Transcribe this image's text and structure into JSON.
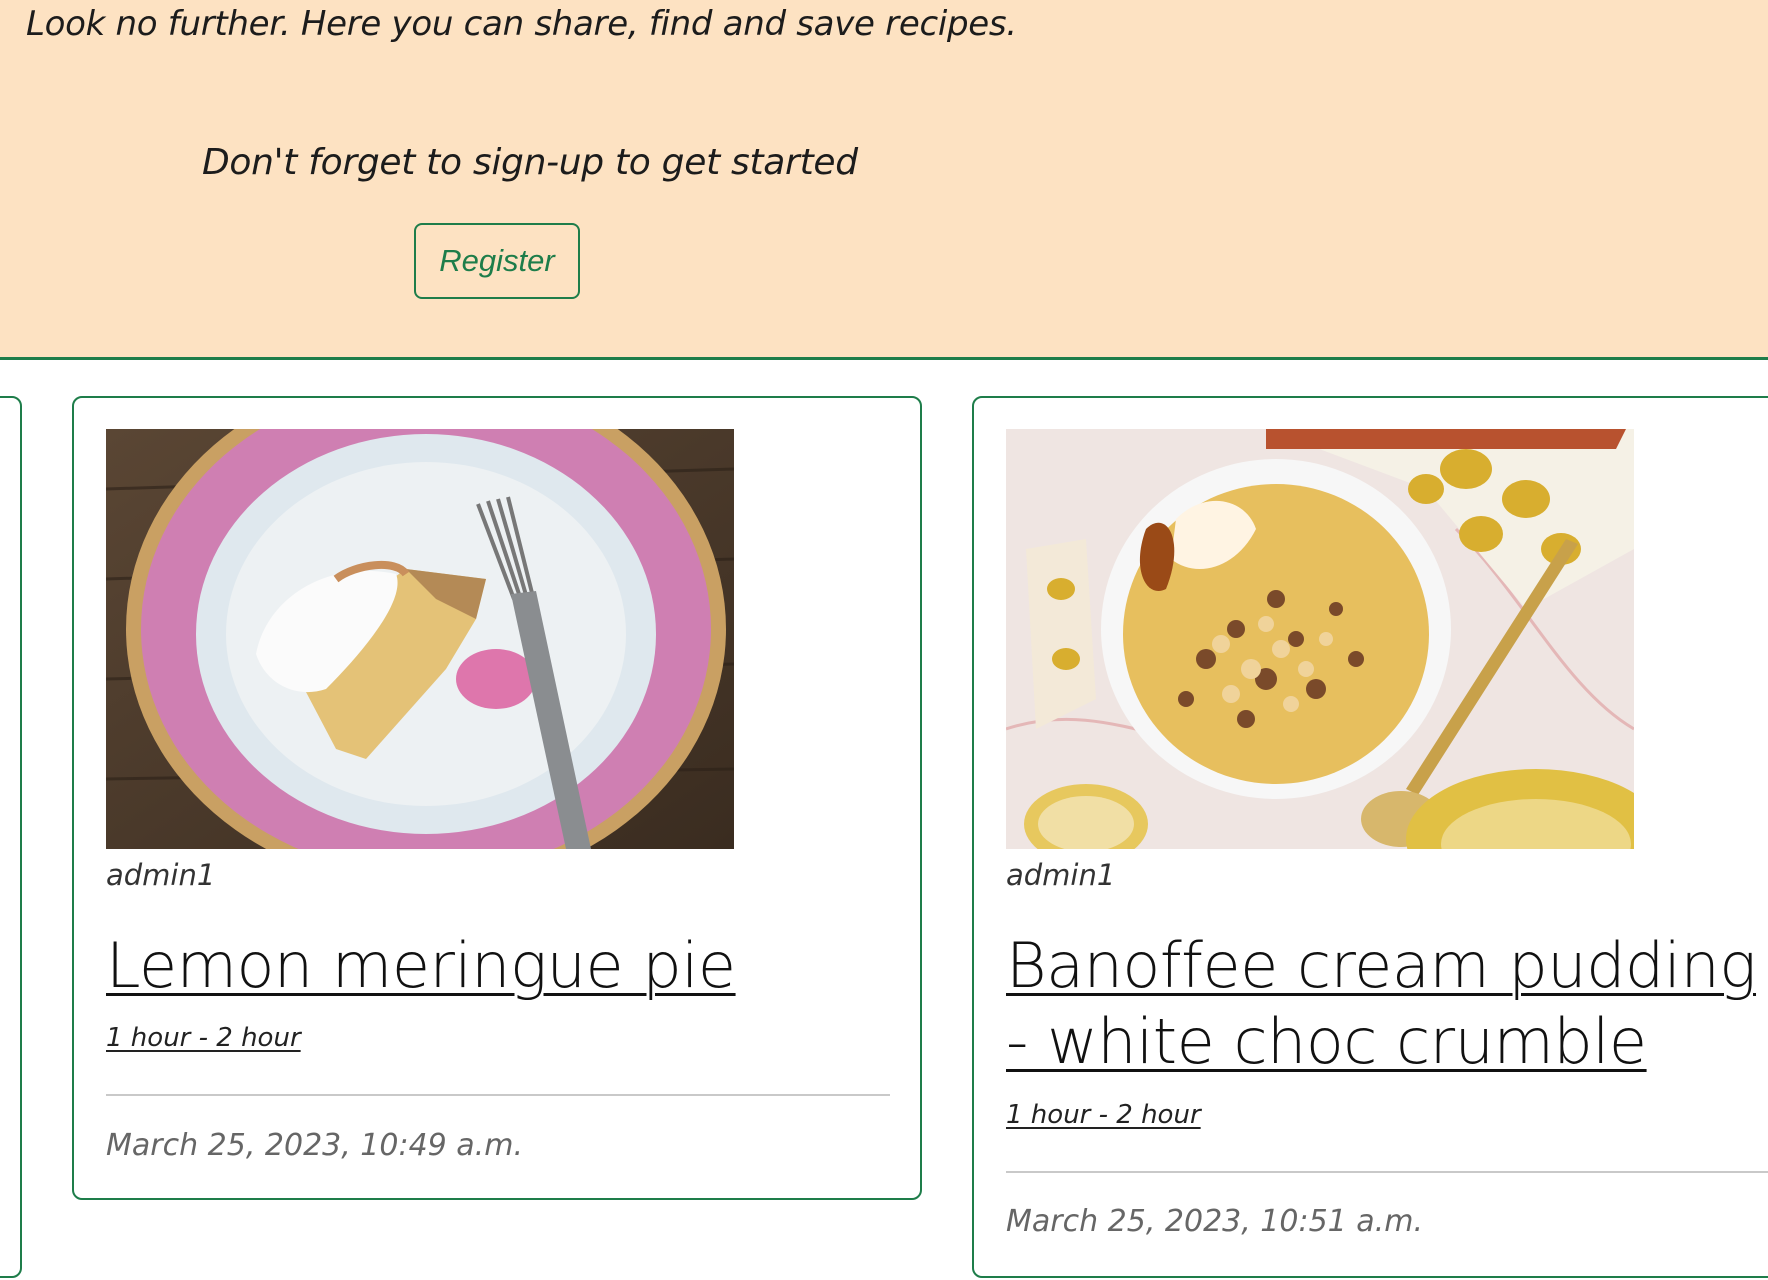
{
  "hero": {
    "tagline": "Look no further. Here you can share, find and save recipes.",
    "signup_prompt": "Don't forget to sign-up to get started",
    "register_label": "Register"
  },
  "recipes": [
    {
      "author": "admin1",
      "title": "Lemon meringue pie",
      "time": "1 hour - 2 hour",
      "date": "March 25, 2023, 10:49 a.m."
    },
    {
      "author": "admin1",
      "title": "Banoffee cream pudding - white choc crumble",
      "time": "1 hour - 2 hour",
      "date": "March 25, 2023, 10:51 a.m."
    }
  ],
  "colors": {
    "accent": "#1e7d4a",
    "hero_bg": "#fde2c2"
  }
}
